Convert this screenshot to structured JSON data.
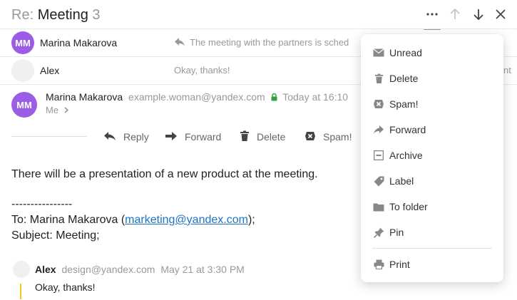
{
  "header": {
    "re_prefix": "Re:",
    "subject": "Meeting",
    "count": "3",
    "icons": [
      "more-icon",
      "arrow-up-icon",
      "arrow-down-icon",
      "close-icon"
    ]
  },
  "thread": [
    {
      "initials": "MM",
      "avatar_color": "#9b5de5",
      "name": "Marina Makarova",
      "snippet": "The meeting with the partners is sched",
      "reply_icon": "reply-icon"
    },
    {
      "initials": "",
      "avatar_color": "#f0f0f0",
      "name": "Alex",
      "snippet": "Okay, thanks!",
      "right_fragment": "nt"
    }
  ],
  "message": {
    "initials": "MM",
    "avatar_color": "#9b5de5",
    "sender_name": "Marina Makarova",
    "sender_email": "example.woman@yandex.com",
    "lock_color": "#2ea043",
    "time": "Today at 16:10",
    "recipient": "Me",
    "actions": {
      "reply": "Reply",
      "forward": "Forward",
      "delete": "Delete",
      "spam": "Spam!"
    },
    "body_line1": "There will be a presentation of a new product at the meeting.",
    "divider": "----------------",
    "to_prefix": "To: Marina Makarova (",
    "to_email": "marketing@yandex.com",
    "to_suffix": ");",
    "subject_line": "Subject: Meeting;"
  },
  "quoted": {
    "name": "Alex",
    "email": "design@yandex.com",
    "date": "May 21 at 3:30 PM",
    "text": "Okay, thanks!",
    "bar_color": "#f5c518"
  },
  "menu": {
    "items": [
      {
        "label": "Unread",
        "icon": "envelope-icon"
      },
      {
        "label": "Delete",
        "icon": "trash-icon"
      },
      {
        "label": "Spam!",
        "icon": "spam-icon"
      },
      {
        "label": "Forward",
        "icon": "forward-icon"
      },
      {
        "label": "Archive",
        "icon": "archive-icon"
      },
      {
        "label": "Label",
        "icon": "tag-icon"
      },
      {
        "label": "To folder",
        "icon": "folder-icon"
      },
      {
        "label": "Pin",
        "icon": "pin-icon"
      },
      {
        "label": "Print",
        "icon": "printer-icon"
      }
    ]
  }
}
